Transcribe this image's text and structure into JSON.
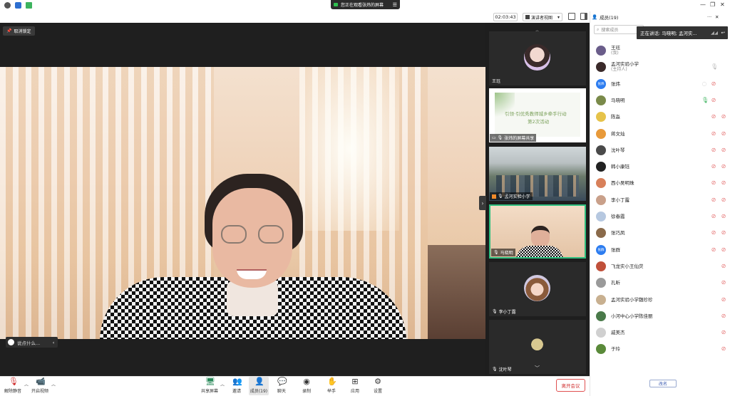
{
  "titlebar": {
    "share_text": "您正在观看张炜的屏幕"
  },
  "toprow": {
    "timer": "02:03:43",
    "view_mode": "演讲者视图"
  },
  "main": {
    "unlock_label": "取消锁定",
    "chat_placeholder": "说点什么..."
  },
  "gallery": [
    {
      "label": "王珏"
    },
    {
      "label": "张炜的屏幕共享",
      "slide_line1": "引领·引优秀教师城乡牵手行动",
      "slide_line2": "第2次活动"
    },
    {
      "label": "孟河实验小学"
    },
    {
      "label": "马晓明"
    },
    {
      "label": "李小丁露"
    },
    {
      "label": "沈叶琴"
    }
  ],
  "panel": {
    "title": "成员(19)",
    "search_placeholder": "搜索成员",
    "speaking_text": "正在讲话: 马晓明; 孟河实...",
    "invite_label": "改名",
    "members": [
      {
        "name": "王珏",
        "sub": "(我)",
        "avatar_color": "#6a5d8a"
      },
      {
        "name": "孟河实验小学",
        "sub": "(主持人)",
        "avatar_color": "#3a2a2a"
      },
      {
        "name": "张炜",
        "sub": "",
        "avatar_color": "#2d7df0",
        "avatar_text": "张炜"
      },
      {
        "name": "马晓明",
        "sub": "",
        "avatar_color": "#7a8a4a"
      },
      {
        "name": "陈淼",
        "sub": "",
        "avatar_color": "#e6c34a"
      },
      {
        "name": "蒋文灿",
        "sub": "",
        "avatar_color": "#e89a3a"
      },
      {
        "name": "沈叶琴",
        "sub": "",
        "avatar_color": "#4a4a4a"
      },
      {
        "name": "韩小康钰",
        "sub": "",
        "avatar_color": "#222222"
      },
      {
        "name": "西小吴明珠",
        "sub": "",
        "avatar_color": "#d8805a"
      },
      {
        "name": "李小丁露",
        "sub": "",
        "avatar_color": "#c9a08a"
      },
      {
        "name": "徐春霞",
        "sub": "",
        "avatar_color": "#b6c8e0"
      },
      {
        "name": "张巧凤",
        "sub": "",
        "avatar_color": "#8a6a4a"
      },
      {
        "name": "张群",
        "sub": "",
        "avatar_color": "#2d7df0",
        "avatar_text": "张群"
      },
      {
        "name": "飞龙实小王仙荧",
        "sub": "",
        "avatar_color": "#c0503a"
      },
      {
        "name": "孔昕",
        "sub": "",
        "avatar_color": "#9a9a9a"
      },
      {
        "name": "孟河实验小学魏珍珍",
        "sub": "",
        "avatar_color": "#c8b090"
      },
      {
        "name": "小河中心小学陈佳丽",
        "sub": "",
        "avatar_color": "#4a7a4a"
      },
      {
        "name": "戚美杰",
        "sub": "",
        "avatar_color": "#d0d0d0"
      },
      {
        "name": "于玲",
        "sub": "",
        "avatar_color": "#5a8a3a"
      }
    ]
  },
  "toolbar": {
    "unmute": "解除静音",
    "start_video": "开启视频",
    "share_screen": "共享屏幕",
    "invite": "邀请",
    "members": "成员(19)",
    "chat": "聊天",
    "record": "录制",
    "raise_hand": "举手",
    "apps": "应用",
    "settings": "设置",
    "leave": "离开会议"
  },
  "colors": {
    "accent_green": "#2fbf7f",
    "leave_red": "#d03030",
    "mic_off_red": "#e57373"
  }
}
